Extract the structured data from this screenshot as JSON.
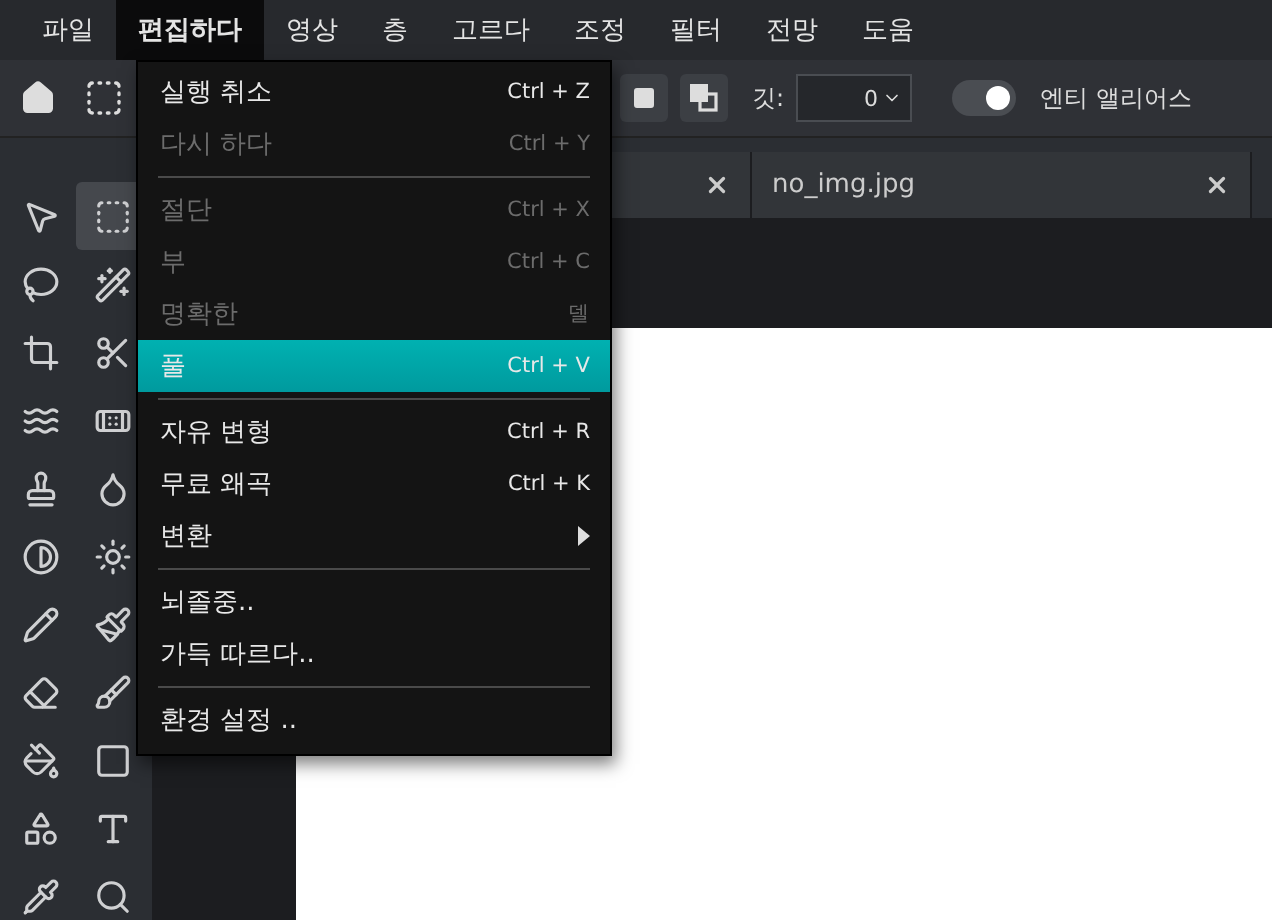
{
  "menubar": [
    {
      "label": "파일",
      "selected": false
    },
    {
      "label": "편집하다",
      "selected": true
    },
    {
      "label": "영상",
      "selected": false
    },
    {
      "label": "층",
      "selected": false
    },
    {
      "label": "고르다",
      "selected": false
    },
    {
      "label": "조정",
      "selected": false
    },
    {
      "label": "필터",
      "selected": false
    },
    {
      "label": "전망",
      "selected": false
    },
    {
      "label": "도움",
      "selected": false
    }
  ],
  "toolbar": {
    "feather_label": "깃:",
    "feather_value": "0",
    "antialias": {
      "label": "엔티 앨리어스",
      "on": true
    }
  },
  "tabs": [
    {
      "selected": false
    },
    {
      "label": "no_img.jpg",
      "selected": false
    }
  ],
  "tools": [
    {
      "selected": false
    },
    {
      "selected": true
    },
    {
      "selected": false
    },
    {
      "selected": false
    },
    {
      "selected": false
    },
    {
      "selected": false
    },
    {
      "selected": false
    },
    {
      "selected": false
    },
    {
      "selected": false
    },
    {
      "selected": false
    },
    {
      "selected": false
    },
    {
      "selected": false
    },
    {
      "selected": false
    },
    {
      "selected": false
    },
    {
      "selected": false
    },
    {
      "selected": false
    },
    {
      "selected": false
    },
    {
      "selected": false
    },
    {
      "selected": false
    },
    {
      "selected": false
    },
    {
      "selected": false
    },
    {
      "selected": false
    }
  ],
  "edit_menu": [
    {
      "kind": "item",
      "label": "실행 취소",
      "shortcut": "Ctrl + Z",
      "disabled": false,
      "selected": false
    },
    {
      "kind": "item",
      "label": "다시 하다",
      "shortcut": "Ctrl + Y",
      "disabled": true,
      "selected": false
    },
    {
      "kind": "separator"
    },
    {
      "kind": "item",
      "label": "절단",
      "shortcut": "Ctrl + X",
      "disabled": true,
      "selected": false
    },
    {
      "kind": "item",
      "label": "부",
      "shortcut": "Ctrl + C",
      "disabled": true,
      "selected": false
    },
    {
      "kind": "item",
      "label": "명확한",
      "shortcut": "델",
      "disabled": true,
      "selected": false
    },
    {
      "kind": "item",
      "label": "풀",
      "shortcut": "Ctrl + V",
      "disabled": false,
      "selected": true
    },
    {
      "kind": "separator"
    },
    {
      "kind": "item",
      "label": "자유 변형",
      "shortcut": "Ctrl + R",
      "disabled": false,
      "selected": false
    },
    {
      "kind": "item",
      "label": "무료 왜곡",
      "shortcut": "Ctrl + K",
      "disabled": false,
      "selected": false
    },
    {
      "kind": "submenu",
      "label": "변환",
      "disabled": false,
      "selected": false
    },
    {
      "kind": "separator"
    },
    {
      "kind": "item",
      "label": "뇌졸중..",
      "disabled": false,
      "selected": false
    },
    {
      "kind": "item",
      "label": "가득 따르다..",
      "disabled": false,
      "selected": false
    },
    {
      "kind": "separator"
    },
    {
      "kind": "item",
      "label": "환경 설정 ..",
      "disabled": false,
      "selected": false
    }
  ]
}
